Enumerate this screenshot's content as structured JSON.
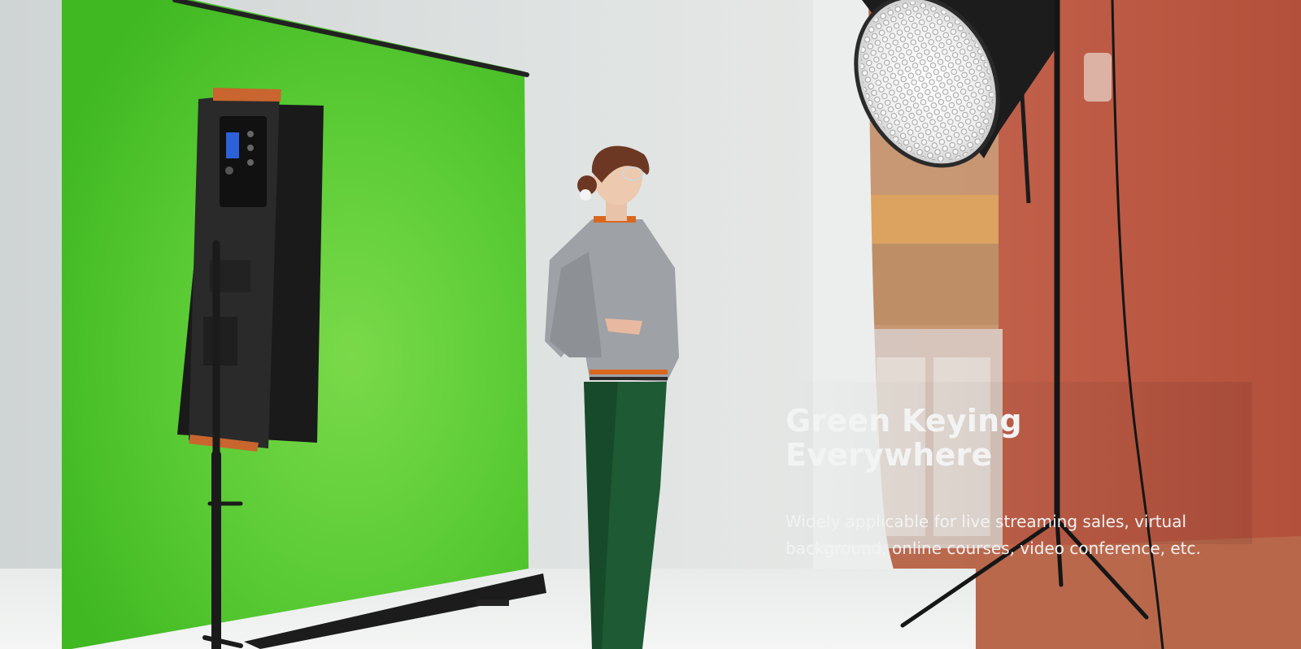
{
  "hero": {
    "heading": "Green Keying Everywhere",
    "description": "Widely applicable for live streaming sales, virtual background, online courses, video conference, etc."
  },
  "colors": {
    "chroma_green": "#4fcb2e",
    "backdrop_wall": "#d9dedd",
    "warm_wall": "#c1604a",
    "text": "#ffffff"
  },
  "scene": {
    "subjects": [
      "green-screen-backdrop",
      "led-panel-light",
      "light-stand",
      "person",
      "softbox-light",
      "room-background"
    ]
  }
}
